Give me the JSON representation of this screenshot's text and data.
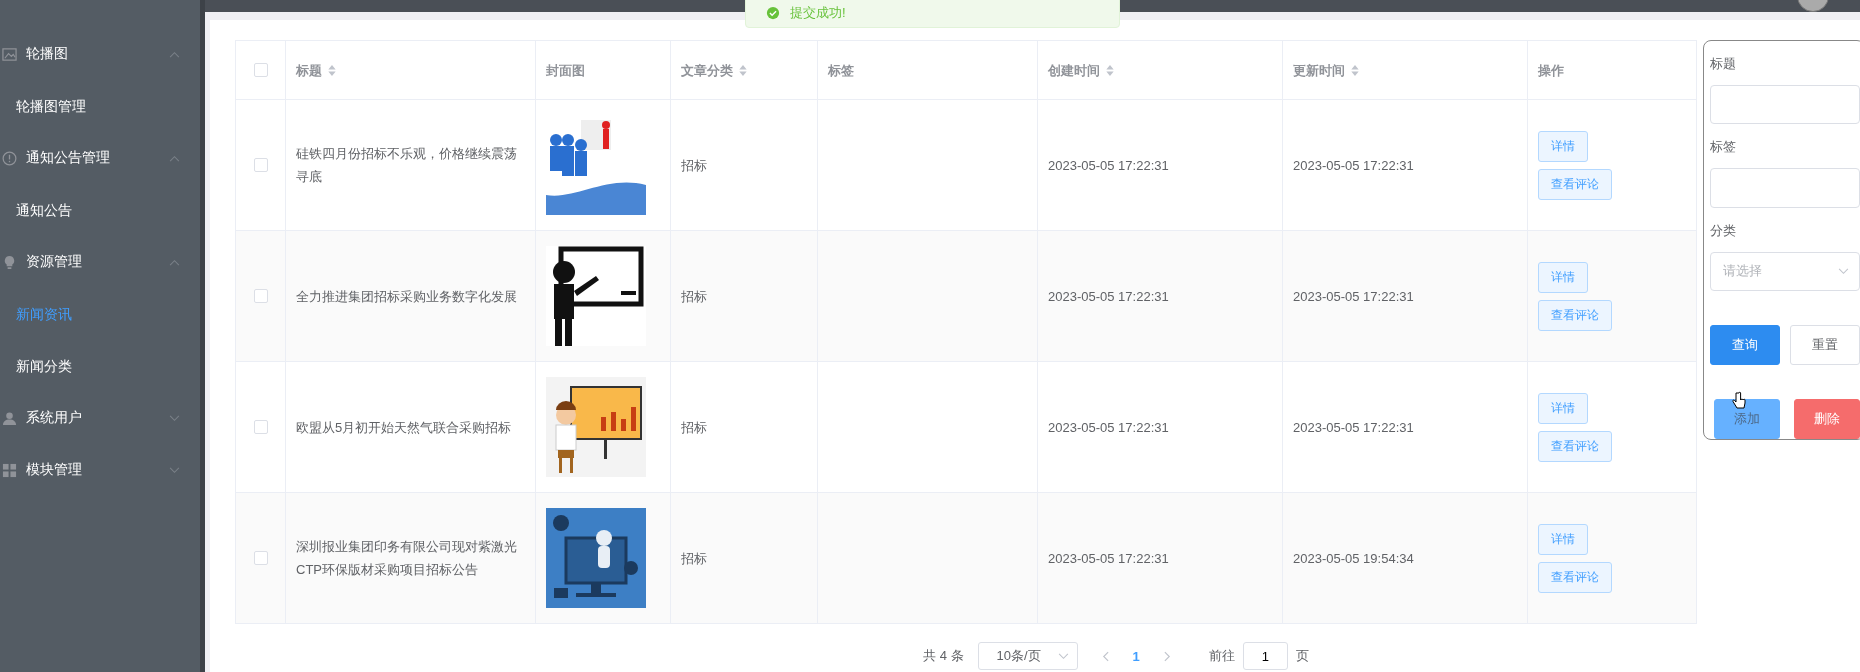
{
  "sidebar": {
    "groups": [
      {
        "label": "轮播图",
        "expanded": true,
        "children": [
          {
            "label": "轮播图管理",
            "selected": false
          }
        ]
      },
      {
        "label": "通知公告管理",
        "expanded": true,
        "children": [
          {
            "label": "通知公告",
            "selected": false
          }
        ]
      },
      {
        "label": "资源管理",
        "expanded": true,
        "children": [
          {
            "label": "新闻资讯",
            "selected": true
          },
          {
            "label": "新闻分类",
            "selected": false
          }
        ]
      },
      {
        "label": "系统用户",
        "expanded": false
      },
      {
        "label": "模块管理",
        "expanded": false
      }
    ]
  },
  "toast": {
    "text": "提交成功!"
  },
  "table": {
    "all_checked": false,
    "columns": [
      {
        "label": "标题",
        "sortable": true
      },
      {
        "label": "封面图",
        "sortable": false
      },
      {
        "label": "文章分类",
        "sortable": true
      },
      {
        "label": "标签",
        "sortable": false
      },
      {
        "label": "创建时间",
        "sortable": true
      },
      {
        "label": "更新时间",
        "sortable": true
      },
      {
        "label": "操作",
        "sortable": false
      }
    ],
    "rows": [
      {
        "checked": false,
        "title": "硅铁四月份招标不乐观，价格继续震荡寻底",
        "cover": {
          "kind": "picture"
        },
        "category": "招标",
        "created": "2023-05-05 17:22:31",
        "updated": "2023-05-05 17:22:31",
        "actions": [
          "详情",
          "查看评论"
        ]
      },
      {
        "checked": false,
        "title": "全力推进集团招标采购业务数字化发展",
        "cover": {
          "kind": "picture"
        },
        "category": "招标",
        "created": "2023-05-05 17:22:31",
        "updated": "2023-05-05 17:22:31",
        "actions": [
          "详情",
          "查看评论"
        ]
      },
      {
        "checked": false,
        "title": "欧盟从5月初开始天然气联合采购招标",
        "cover": {
          "kind": "picture"
        },
        "category": "招标",
        "created": "2023-05-05 17:22:31",
        "updated": "2023-05-05 17:22:31",
        "actions": [
          "详情",
          "查看评论"
        ]
      },
      {
        "checked": false,
        "title": "深圳报业集团印务有限公司现对紫激光CTP环保版材采购项目招标公告",
        "cover": {
          "kind": "picture"
        },
        "category": "招标",
        "created": "2023-05-05 17:22:31",
        "updated": "2023-05-05 19:54:34",
        "actions": [
          "详情",
          "查看评论"
        ]
      }
    ]
  },
  "pagination": {
    "total": "共 4 条",
    "page_size": "10条/页",
    "pages": [
      {
        "label": "1",
        "selected": true
      }
    ],
    "goto_label": "前往",
    "goto_value": "1",
    "goto_suffix": "页"
  },
  "filter": {
    "fields": [
      {
        "kind": "input",
        "label": "标题"
      },
      {
        "kind": "input",
        "label": "标签"
      },
      {
        "kind": "select",
        "label": "分类",
        "placeholder": "请选择"
      }
    ],
    "buttons": [
      {
        "label": "查询",
        "kind": "primary"
      },
      {
        "label": "重置",
        "kind": "plain"
      },
      {
        "label": "添加",
        "kind": "hover"
      },
      {
        "label": "删除",
        "kind": "danger"
      }
    ]
  }
}
